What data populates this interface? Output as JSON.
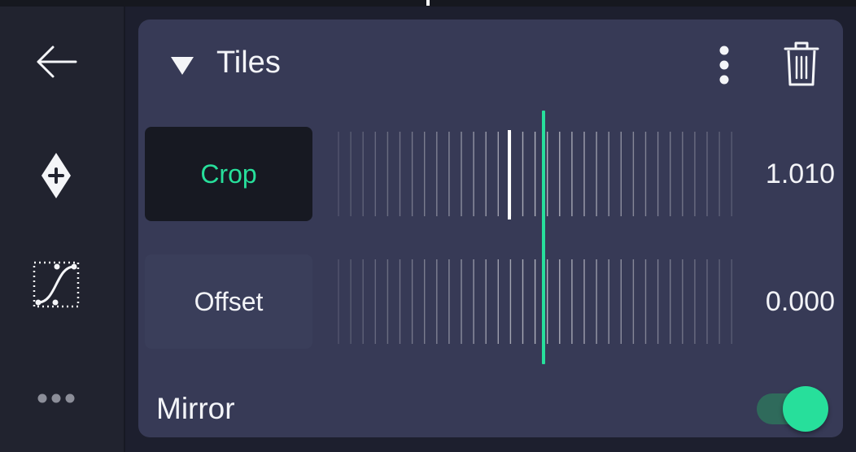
{
  "topbar": {
    "marker": "playhead-marker"
  },
  "sidebar": {
    "items": [
      {
        "icon": "back-arrow-icon"
      },
      {
        "icon": "add-keyframe-icon"
      },
      {
        "icon": "easing-curve-icon"
      },
      {
        "icon": "more-horizontal-icon"
      }
    ]
  },
  "panel": {
    "title": "Tiles",
    "collapse_icon": "triangle-down-icon",
    "menu_icon": "kebab-menu-icon",
    "delete_icon": "trash-icon",
    "params": [
      {
        "label": "Crop",
        "value": "1.010",
        "active": true
      },
      {
        "label": "Offset",
        "value": "0.000",
        "active": false
      }
    ],
    "mirror": {
      "label": "Mirror",
      "enabled": true
    }
  },
  "colors": {
    "accent": "#27df9b",
    "panel": "#373a56",
    "sidebar": "#21232f",
    "active_button": "#171922",
    "background": "#1d1f2e"
  }
}
